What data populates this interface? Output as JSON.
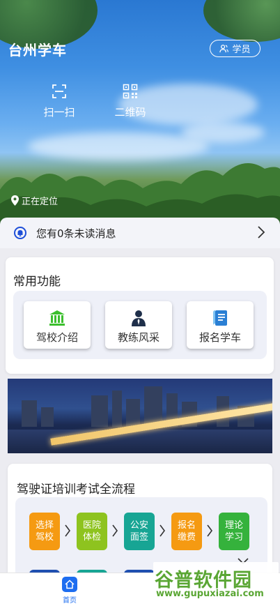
{
  "header": {
    "app_title": "台州学车",
    "role_button": "学员",
    "quick_actions": [
      {
        "label": "扫一扫",
        "icon": "scan-icon"
      },
      {
        "label": "二维码",
        "icon": "qrcode-icon"
      }
    ],
    "location_text": "正在定位"
  },
  "notice": {
    "text": "您有0条未读消息",
    "icon": "bell-icon"
  },
  "common": {
    "title": "常用功能",
    "items": [
      {
        "label": "驾校介绍",
        "icon": "school-building-icon",
        "color": "#3cbf2e"
      },
      {
        "label": "教练风采",
        "icon": "coach-person-icon",
        "color": "#1f2f4a"
      },
      {
        "label": "报名学车",
        "icon": "signup-form-icon",
        "color": "#2a7fd4"
      }
    ]
  },
  "process": {
    "title": "驾驶证培训考试全流程",
    "steps": [
      {
        "label": "选择驾校",
        "color": "#f59a12"
      },
      {
        "label": "医院体检",
        "color": "#8ec31f"
      },
      {
        "label": "公安面签",
        "color": "#17a594"
      },
      {
        "label": "报名缴费",
        "color": "#f59a12"
      },
      {
        "label": "理论学习",
        "color": "#35b23c"
      }
    ]
  },
  "tabbar": {
    "home_label": "首页"
  },
  "watermark": {
    "brand": "谷普软件园",
    "url": "www.gupuxiazai.com"
  },
  "colors": {
    "accent": "#1d6df0",
    "panel_bg": "#eef0f8"
  }
}
